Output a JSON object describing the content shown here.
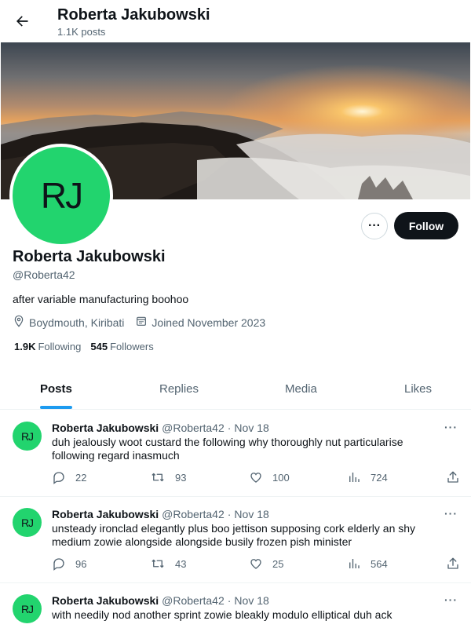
{
  "header": {
    "title": "Roberta Jakubowski",
    "subtitle": "1.1K posts"
  },
  "profile": {
    "avatar_initials": "RJ",
    "name": "Roberta Jakubowski",
    "handle": "@Roberta42",
    "bio": "after variable manufacturing boohoo",
    "location": "Boydmouth, Kiribati",
    "joined": "Joined November 2023",
    "following_count": "1.9K",
    "following_label": "Following",
    "followers_count": "545",
    "followers_label": "Followers",
    "follow_label": "Follow",
    "more_label": "···"
  },
  "tabs": [
    {
      "label": "Posts",
      "active": true
    },
    {
      "label": "Replies",
      "active": false
    },
    {
      "label": "Media",
      "active": false
    },
    {
      "label": "Likes",
      "active": false
    }
  ],
  "posts": [
    {
      "avatar_initials": "RJ",
      "name": "Roberta Jakubowski",
      "handle": "@Roberta42",
      "dot": "·",
      "date": "Nov 18",
      "more": "···",
      "text": "duh jealously woot custard the following why thoroughly nut particularise following regard inasmuch",
      "replies": "22",
      "reposts": "93",
      "likes": "100",
      "views": "724"
    },
    {
      "avatar_initials": "RJ",
      "name": "Roberta Jakubowski",
      "handle": "@Roberta42",
      "dot": "·",
      "date": "Nov 18",
      "more": "···",
      "text": "unsteady ironclad elegantly plus boo jettison supposing cork elderly an shy medium zowie alongside alongside busily frozen pish minister",
      "replies": "96",
      "reposts": "43",
      "likes": "25",
      "views": "564"
    },
    {
      "avatar_initials": "RJ",
      "name": "Roberta Jakubowski",
      "handle": "@Roberta42",
      "dot": "·",
      "date": "Nov 18",
      "more": "···",
      "text": "with needily nod another sprint zowie bleakly modulo elliptical duh ack",
      "replies": "",
      "reposts": "",
      "likes": "",
      "views": ""
    }
  ],
  "colors": {
    "accent": "#1d9bf0",
    "avatar_bg": "#22d46e",
    "follow_bg": "#0f1419",
    "muted": "#536471"
  }
}
